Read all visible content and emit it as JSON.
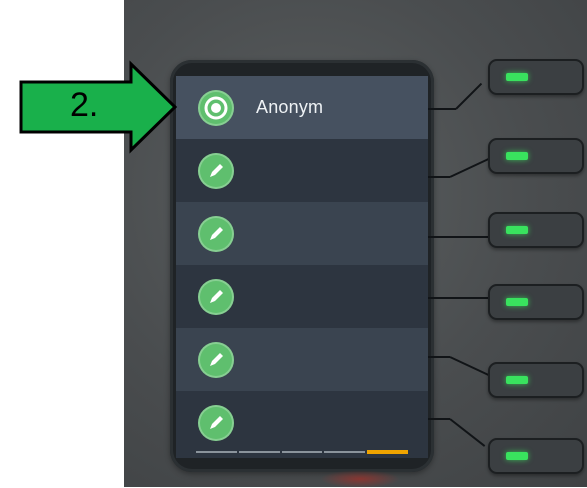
{
  "annotation": {
    "step_label": "2."
  },
  "screen": {
    "rows": [
      {
        "icon": "target-icon",
        "label": "Anonym"
      },
      {
        "icon": "pencil-icon",
        "label": ""
      },
      {
        "icon": "pencil-icon",
        "label": ""
      },
      {
        "icon": "pencil-icon",
        "label": ""
      },
      {
        "icon": "pencil-icon",
        "label": ""
      },
      {
        "icon": "pencil-icon",
        "label": ""
      }
    ],
    "page_indicator": {
      "pages": 5,
      "active_page": 5
    }
  },
  "colors": {
    "icon_green": "#5fbf6e",
    "led_green": "#39e25e",
    "page_active": "#f0a400",
    "arrow_green": "#19b04b"
  }
}
